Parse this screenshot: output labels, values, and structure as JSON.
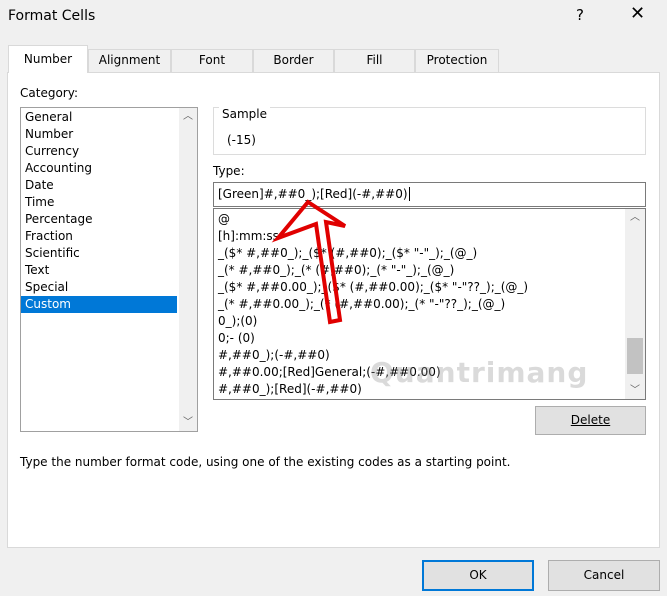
{
  "window": {
    "title": "Format Cells",
    "help": "?",
    "close": "✕"
  },
  "tabs": [
    {
      "label": "Number",
      "active": true
    },
    {
      "label": "Alignment"
    },
    {
      "label": "Font"
    },
    {
      "label": "Border"
    },
    {
      "label": "Fill"
    },
    {
      "label": "Protection"
    }
  ],
  "category": {
    "label": "Category:",
    "items": [
      "General",
      "Number",
      "Currency",
      "Accounting",
      "Date",
      "Time",
      "Percentage",
      "Fraction",
      "Scientific",
      "Text",
      "Special",
      "Custom"
    ],
    "selected": "Custom"
  },
  "sample": {
    "label": "Sample",
    "value": "(-15)"
  },
  "type": {
    "label": "Type:",
    "value": "[Green]#,##0_);[Red](-#,##0)",
    "list": [
      "@",
      "[h]:mm:ss",
      "_($* #,##0_);_($* (#,##0);_($* \"-\"_);_(@_)",
      "_(* #,##0_);_(* (#,##0);_(* \"-\"_);_(@_)",
      "_($* #,##0.00_);_($* (#,##0.00);_($* \"-\"??_);_(@_)",
      "_(* #,##0.00_);_(* (#,##0.00);_(* \"-\"??_);_(@_)",
      "0_);(0)",
      "0;- (0)",
      "#,##0_);(-#,##0)",
      "#,##0.00;[Red]General;(-#,##0.00)",
      "#,##0_);[Red](-#,##0)"
    ]
  },
  "buttons": {
    "delete": "Delete",
    "ok": "OK",
    "cancel": "Cancel"
  },
  "description": "Type the number format code, using one of the existing codes as a starting point.",
  "watermark": "Quantrimang",
  "colors": {
    "selection": "#0078d7",
    "arrow": "#e00000"
  }
}
